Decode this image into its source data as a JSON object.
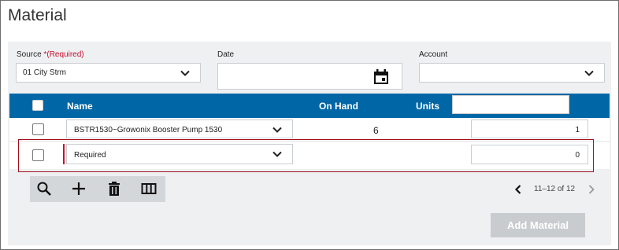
{
  "page": {
    "title": "Material"
  },
  "form": {
    "source_label": "Source",
    "source_required": "*(Required)",
    "source_value": "01 City Strm",
    "date_label": "Date",
    "date_value": "",
    "account_label": "Account",
    "account_value": ""
  },
  "table": {
    "headers": {
      "name": "Name",
      "on_hand": "On Hand",
      "units": "Units"
    },
    "units_filter_value": "",
    "rows": [
      {
        "name": "BSTR1530~Growonix Booster Pump 1530",
        "on_hand": "6",
        "units": "1",
        "checked": false
      },
      {
        "name": "Required",
        "on_hand": "",
        "units": "0",
        "checked": false,
        "invalid": true
      }
    ]
  },
  "toolbar": {
    "icons": [
      "search-icon",
      "add-icon",
      "trash-icon",
      "columns-icon"
    ]
  },
  "pager": {
    "range": "11–12 of 12"
  },
  "actions": {
    "add_material_label": "Add Material"
  },
  "colors": {
    "header_bg": "#0066a6",
    "required": "#c8102e",
    "error_border": "#a40f1e",
    "panel_bg": "#eef0f2"
  }
}
